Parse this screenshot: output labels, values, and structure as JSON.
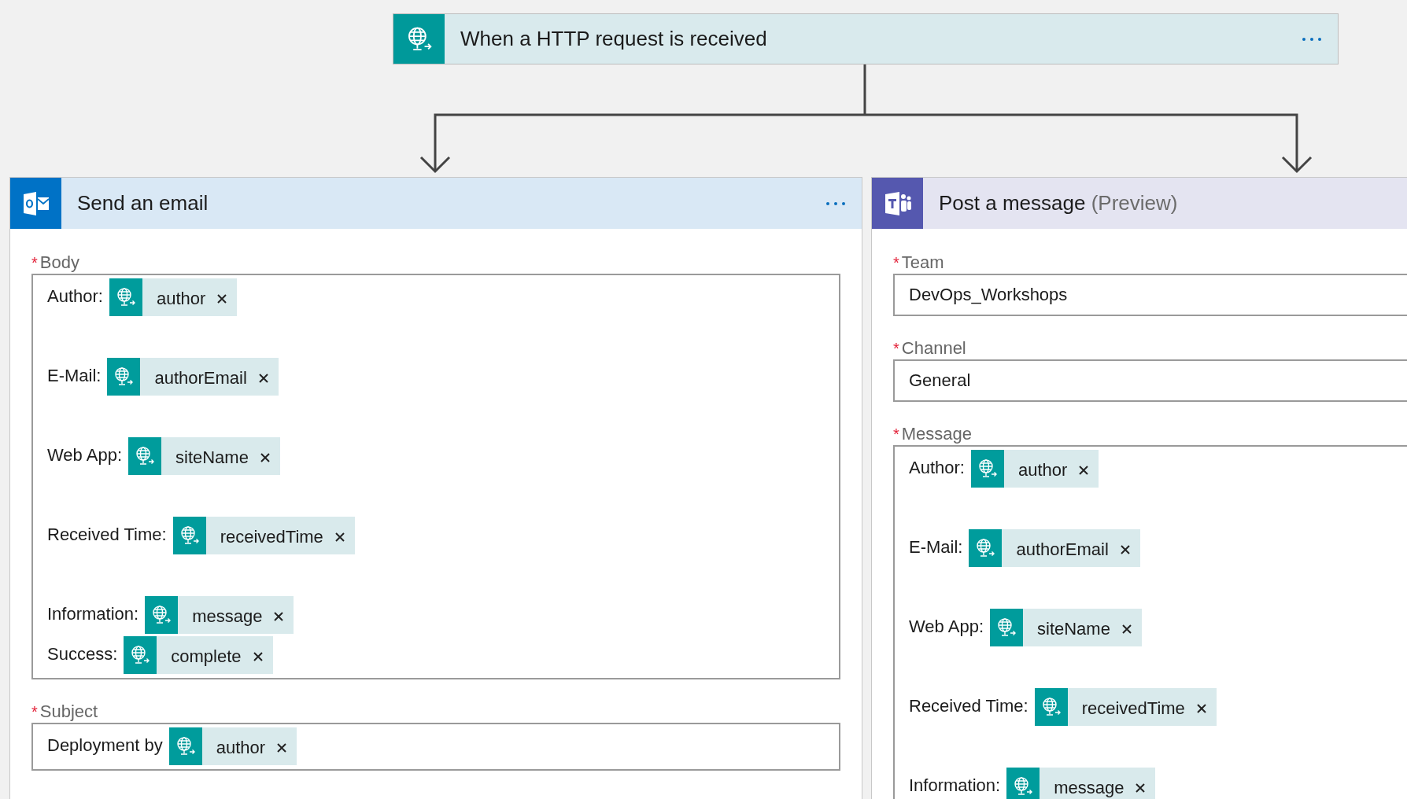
{
  "trigger": {
    "title": "When a HTTP request is received",
    "menu": true
  },
  "actions": [
    {
      "kind": "outlook",
      "title": "Send an email",
      "menu": true,
      "fields": [
        {
          "kind": "rich",
          "label": "Body",
          "required_mark": "*",
          "paragraphs": [
            [
              {
                "label": "Author:",
                "token": "author"
              }
            ],
            [
              {
                "label": "E-Mail:",
                "token": "authorEmail"
              }
            ],
            [
              {
                "label": "Web App:",
                "token": "siteName"
              }
            ],
            [
              {
                "label": "Received Time:",
                "token": "receivedTime"
              }
            ],
            [
              {
                "label": "Information:",
                "token": "message"
              },
              {
                "label": "Success:",
                "token": "complete"
              }
            ]
          ]
        },
        {
          "kind": "rich",
          "label": "Subject",
          "required_mark": "*",
          "paragraphs": [
            [
              {
                "label": "Deployment by",
                "token": "author"
              }
            ]
          ]
        }
      ]
    },
    {
      "kind": "teams",
      "title": "Post a message",
      "title_suffix": "(Preview)",
      "fields": [
        {
          "kind": "text",
          "label": "Team",
          "required_mark": "*",
          "value": "DevOps_Workshops"
        },
        {
          "kind": "text",
          "label": "Channel",
          "required_mark": "*",
          "value": "General"
        },
        {
          "kind": "rich",
          "label": "Message",
          "required_mark": "*",
          "paragraphs": [
            [
              {
                "label": "Author:",
                "token": "author"
              }
            ],
            [
              {
                "label": "E-Mail:",
                "token": "authorEmail"
              }
            ],
            [
              {
                "label": "Web App:",
                "token": "siteName"
              }
            ],
            [
              {
                "label": "Received Time:",
                "token": "receivedTime"
              }
            ],
            [
              {
                "label": "Information:",
                "token": "message"
              }
            ]
          ]
        }
      ]
    }
  ]
}
